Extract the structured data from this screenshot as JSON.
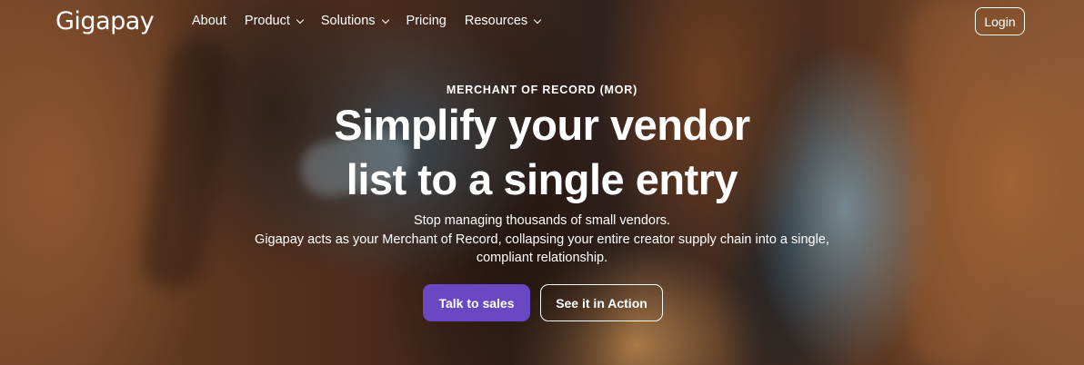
{
  "brand": {
    "logo_text": "Gigapay"
  },
  "nav": {
    "items": [
      {
        "label": "About",
        "has_dropdown": false
      },
      {
        "label": "Product",
        "has_dropdown": true
      },
      {
        "label": "Solutions",
        "has_dropdown": true
      },
      {
        "label": "Pricing",
        "has_dropdown": false
      },
      {
        "label": "Resources",
        "has_dropdown": true
      }
    ],
    "login_label": "Login"
  },
  "hero": {
    "eyebrow": "MERCHANT OF RECORD (MOR)",
    "headline_line1": "Simplify your vendor",
    "headline_line2": "list to a single entry",
    "subtext_line1": "Stop managing thousands of small vendors.",
    "subtext_line2": "Gigapay acts as your Merchant of Record, collapsing your entire creator supply chain into a single,",
    "subtext_line3": "compliant relationship.",
    "primary_cta": "Talk to sales",
    "secondary_cta": "See it in Action"
  },
  "colors": {
    "primary_button": "#6a48c4",
    "text": "#ffffff"
  }
}
